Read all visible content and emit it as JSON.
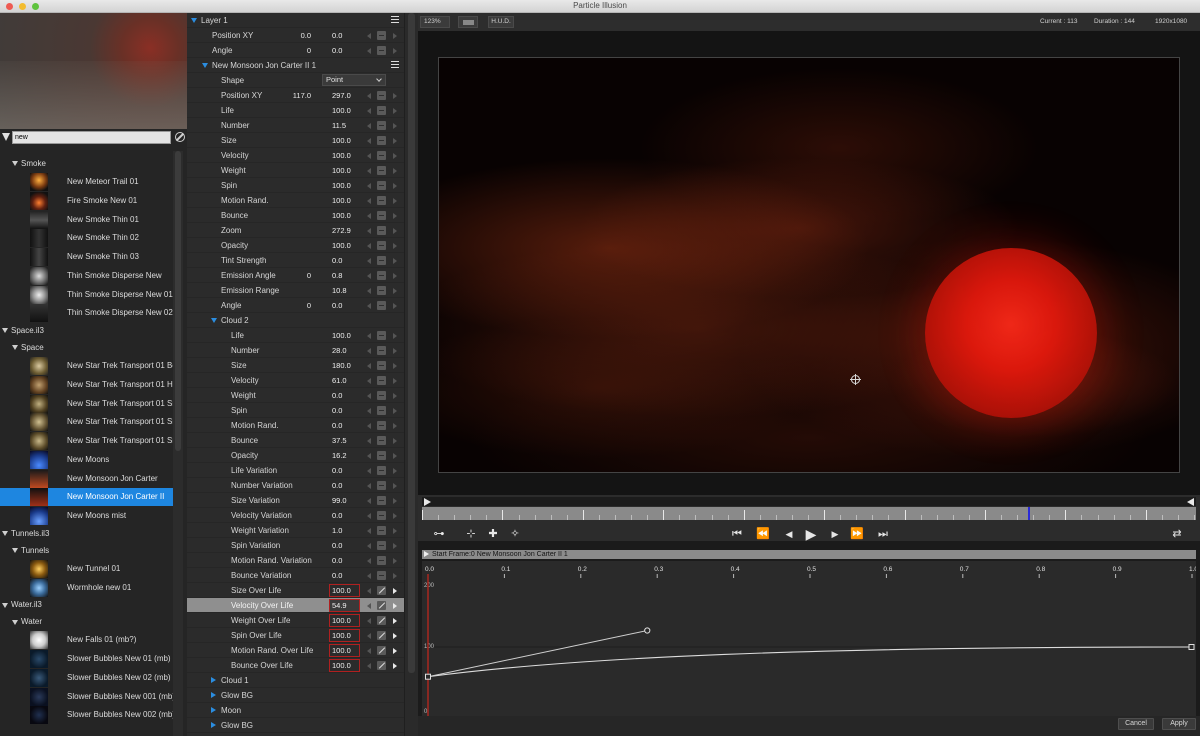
{
  "window": {
    "title": "Particle Illusion"
  },
  "library": {
    "search": {
      "value": "new"
    },
    "groups": [
      {
        "type": "category",
        "label": "Smoke",
        "level": 1
      },
      {
        "type": "item",
        "label": "New Meteor Trail 01"
      },
      {
        "type": "item",
        "label": "Fire Smoke New 01"
      },
      {
        "type": "item",
        "label": "New Smoke Thin 01"
      },
      {
        "type": "item",
        "label": "New Smoke Thin 02"
      },
      {
        "type": "item",
        "label": "New Smoke Thin 03"
      },
      {
        "type": "item",
        "label": "Thin Smoke Disperse New"
      },
      {
        "type": "item",
        "label": "Thin Smoke Disperse New 01"
      },
      {
        "type": "item",
        "label": "Thin Smoke Disperse New 02"
      },
      {
        "type": "category",
        "label": "Space.il3",
        "level": 0
      },
      {
        "type": "category",
        "label": "Space",
        "level": 1
      },
      {
        "type": "item",
        "label": "New Star Trek Transport 01 Bo"
      },
      {
        "type": "item",
        "label": "New Star Trek Transport 01 He"
      },
      {
        "type": "item",
        "label": "New Star Trek Transport 01 Sr"
      },
      {
        "type": "item",
        "label": "New Star Trek Transport 01 Sr"
      },
      {
        "type": "item",
        "label": "New Star Trek Transport 01 Sr"
      },
      {
        "type": "item",
        "label": "New Moons"
      },
      {
        "type": "item",
        "label": "New Monsoon Jon Carter"
      },
      {
        "type": "item",
        "label": "New Monsoon Jon Carter II",
        "selected": true
      },
      {
        "type": "item",
        "label": "New Moons mist"
      },
      {
        "type": "category",
        "label": "Tunnels.il3",
        "level": 0
      },
      {
        "type": "category",
        "label": "Tunnels",
        "level": 1
      },
      {
        "type": "item",
        "label": "New Tunnel 01"
      },
      {
        "type": "item",
        "label": "Wormhole new 01"
      },
      {
        "type": "category",
        "label": "Water.il3",
        "level": 0
      },
      {
        "type": "category",
        "label": "Water",
        "level": 1
      },
      {
        "type": "item",
        "label": "New Falls 01 (mb?)"
      },
      {
        "type": "item",
        "label": "Slower Bubbles New 01 (mb)"
      },
      {
        "type": "item",
        "label": "Slower Bubbles New 02 (mb)"
      },
      {
        "type": "item",
        "label": "Slower Bubbles New 001 (mb)"
      },
      {
        "type": "item",
        "label": "Slower Bubbles New 002 (mb)"
      }
    ]
  },
  "properties": [
    {
      "kind": "header",
      "label": "Layer 1",
      "indent": 0,
      "expanded": true,
      "menu": true
    },
    {
      "kind": "pair",
      "label": "Position XY",
      "indent": 1,
      "v1": "0.0",
      "v2": "0.0"
    },
    {
      "kind": "pair",
      "label": "Angle",
      "indent": 1,
      "v1": "0",
      "v2": "0.0"
    },
    {
      "kind": "header",
      "label": "New Monsoon Jon Carter II 1",
      "indent": 1,
      "expanded": true,
      "menu": true
    },
    {
      "kind": "select",
      "label": "Shape",
      "indent": 2,
      "value": "Point"
    },
    {
      "kind": "pair",
      "label": "Position XY",
      "indent": 2,
      "v1": "117.0",
      "v2": "297.0"
    },
    {
      "kind": "value",
      "label": "Life",
      "indent": 2,
      "v2": "100.0"
    },
    {
      "kind": "value",
      "label": "Number",
      "indent": 2,
      "v2": "11.5"
    },
    {
      "kind": "value",
      "label": "Size",
      "indent": 2,
      "v2": "100.0"
    },
    {
      "kind": "value",
      "label": "Velocity",
      "indent": 2,
      "v2": "100.0"
    },
    {
      "kind": "value",
      "label": "Weight",
      "indent": 2,
      "v2": "100.0"
    },
    {
      "kind": "value",
      "label": "Spin",
      "indent": 2,
      "v2": "100.0"
    },
    {
      "kind": "value",
      "label": "Motion Rand.",
      "indent": 2,
      "v2": "100.0"
    },
    {
      "kind": "value",
      "label": "Bounce",
      "indent": 2,
      "v2": "100.0"
    },
    {
      "kind": "value",
      "label": "Zoom",
      "indent": 2,
      "v2": "272.9"
    },
    {
      "kind": "value",
      "label": "Opacity",
      "indent": 2,
      "v2": "100.0"
    },
    {
      "kind": "value",
      "label": "Tint Strength",
      "indent": 2,
      "v2": "0.0"
    },
    {
      "kind": "pair",
      "label": "Emission Angle",
      "indent": 2,
      "v1": "0",
      "v2": "0.8"
    },
    {
      "kind": "value",
      "label": "Emission Range",
      "indent": 2,
      "v2": "10.8"
    },
    {
      "kind": "pair",
      "label": "Angle",
      "indent": 2,
      "v1": "0",
      "v2": "0.0"
    },
    {
      "kind": "header",
      "label": "Cloud 2",
      "indent": 2,
      "expanded": true
    },
    {
      "kind": "value",
      "label": "Life",
      "indent": 3,
      "v2": "100.0"
    },
    {
      "kind": "value",
      "label": "Number",
      "indent": 3,
      "v2": "28.0"
    },
    {
      "kind": "value",
      "label": "Size",
      "indent": 3,
      "v2": "180.0"
    },
    {
      "kind": "value",
      "label": "Velocity",
      "indent": 3,
      "v2": "61.0"
    },
    {
      "kind": "value",
      "label": "Weight",
      "indent": 3,
      "v2": "0.0"
    },
    {
      "kind": "value",
      "label": "Spin",
      "indent": 3,
      "v2": "0.0"
    },
    {
      "kind": "value",
      "label": "Motion Rand.",
      "indent": 3,
      "v2": "0.0"
    },
    {
      "kind": "value",
      "label": "Bounce",
      "indent": 3,
      "v2": "37.5"
    },
    {
      "kind": "value",
      "label": "Opacity",
      "indent": 3,
      "v2": "16.2"
    },
    {
      "kind": "value",
      "label": "Life Variation",
      "indent": 3,
      "v2": "0.0"
    },
    {
      "kind": "value",
      "label": "Number Variation",
      "indent": 3,
      "v2": "0.0"
    },
    {
      "kind": "value",
      "label": "Size Variation",
      "indent": 3,
      "v2": "99.0"
    },
    {
      "kind": "value",
      "label": "Velocity Variation",
      "indent": 3,
      "v2": "0.0"
    },
    {
      "kind": "value",
      "label": "Weight Variation",
      "indent": 3,
      "v2": "1.0"
    },
    {
      "kind": "value",
      "label": "Spin Variation",
      "indent": 3,
      "v2": "0.0"
    },
    {
      "kind": "value",
      "label": "Motion Rand. Variation",
      "indent": 3,
      "v2": "0.0"
    },
    {
      "kind": "value",
      "label": "Bounce Variation",
      "indent": 3,
      "v2": "0.0"
    },
    {
      "kind": "overlife",
      "label": "Size Over Life",
      "indent": 3,
      "v2": "100.0"
    },
    {
      "kind": "overlife",
      "label": "Velocity Over Life",
      "indent": 3,
      "v2": "54.9",
      "selected": true
    },
    {
      "kind": "overlife",
      "label": "Weight Over Life",
      "indent": 3,
      "v2": "100.0"
    },
    {
      "kind": "overlife",
      "label": "Spin Over Life",
      "indent": 3,
      "v2": "100.0"
    },
    {
      "kind": "overlife",
      "label": "Motion Rand. Over Life",
      "indent": 3,
      "v2": "100.0"
    },
    {
      "kind": "overlife",
      "label": "Bounce Over Life",
      "indent": 3,
      "v2": "100.0"
    },
    {
      "kind": "header",
      "label": "Cloud 1",
      "indent": 2,
      "expanded": false
    },
    {
      "kind": "header",
      "label": "Glow BG",
      "indent": 2,
      "expanded": false
    },
    {
      "kind": "header",
      "label": "Moon",
      "indent": 2,
      "expanded": false
    },
    {
      "kind": "header",
      "label": "Glow BG",
      "indent": 2,
      "expanded": false
    }
  ],
  "viewer": {
    "zoom": "123%",
    "hud_label": "H.U.D.",
    "current": "Current : 113",
    "duration": "Duration : 144",
    "resolution": "1920x1080"
  },
  "timeline": {
    "current_frame": 113,
    "duration": 144
  },
  "transport": {
    "buttons": [
      "key-icon",
      "add-key-icon",
      "add-key-2-icon",
      "remove-key-icon",
      "skip-start-icon",
      "rewind-icon",
      "step-back-icon",
      "play-icon",
      "step-forward-icon",
      "fast-forward-icon",
      "skip-end-icon",
      "loop-icon"
    ],
    "glyphs": [
      "⊶",
      "⊹",
      "✚",
      "✧",
      "⏮",
      "⏪",
      "◀",
      "▶",
      "▶",
      "⏩",
      "⏭",
      "⇄"
    ]
  },
  "curve_editor": {
    "header": "Start Frame:0 New Monsoon Jon Carter II 1",
    "x_ticks": [
      "0.0",
      "0.1",
      "0.2",
      "0.3",
      "0.4",
      "0.5",
      "0.6",
      "0.7",
      "0.8",
      "0.9",
      "1.0"
    ],
    "y_labels": [
      "200",
      "100",
      "0"
    ],
    "curve_points": [
      [
        0.0,
        55
      ],
      [
        1.0,
        100
      ]
    ],
    "handle_points": [
      [
        0.0,
        55
      ],
      [
        0.287,
        125
      ]
    ]
  },
  "buttons": {
    "cancel": "Cancel",
    "apply": "Apply"
  },
  "colors": {
    "selection": "#1e86e0",
    "accent_blue": "#2b8de0",
    "highlight_red": "#b02020"
  }
}
